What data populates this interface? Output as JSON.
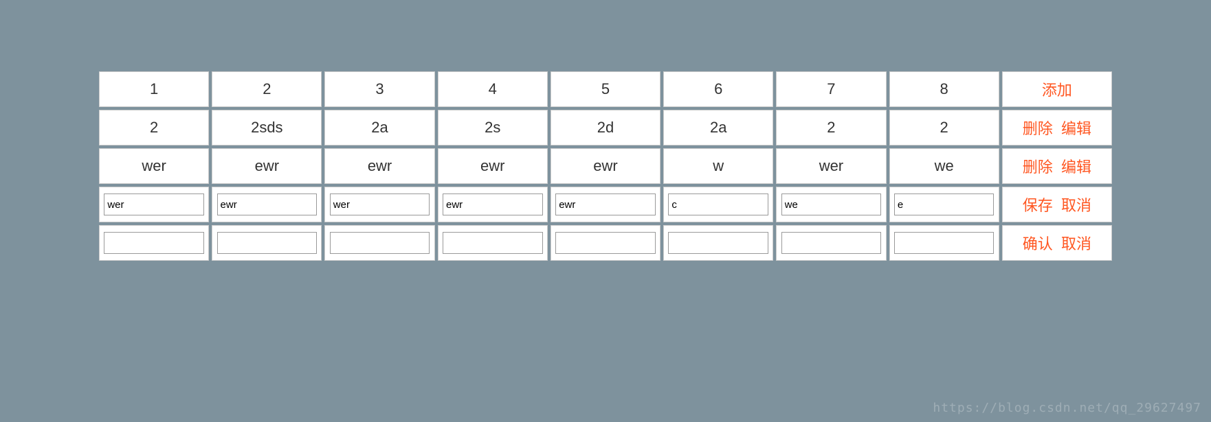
{
  "header": {
    "cols": [
      "1",
      "2",
      "3",
      "4",
      "5",
      "6",
      "7",
      "8"
    ],
    "add": "添加"
  },
  "rows": [
    {
      "cells": [
        "2",
        "2sds",
        "2a",
        "2s",
        "2d",
        "2a",
        "2",
        "2"
      ],
      "actions": {
        "delete": "删除",
        "edit": "编辑"
      }
    },
    {
      "cells": [
        "wer",
        "ewr",
        "ewr",
        "ewr",
        "ewr",
        "w",
        "wer",
        "we"
      ],
      "actions": {
        "delete": "删除",
        "edit": "编辑"
      }
    }
  ],
  "editRow": {
    "values": [
      "wer",
      "ewr",
      "wer",
      "ewr",
      "ewr",
      "c",
      "we",
      "e"
    ],
    "actions": {
      "save": "保存",
      "cancel": "取消"
    }
  },
  "newRow": {
    "values": [
      "",
      "",
      "",
      "",
      "",
      "",
      "",
      ""
    ],
    "actions": {
      "confirm": "确认",
      "cancel": "取消"
    }
  },
  "watermark": "https://blog.csdn.net/qq_29627497"
}
